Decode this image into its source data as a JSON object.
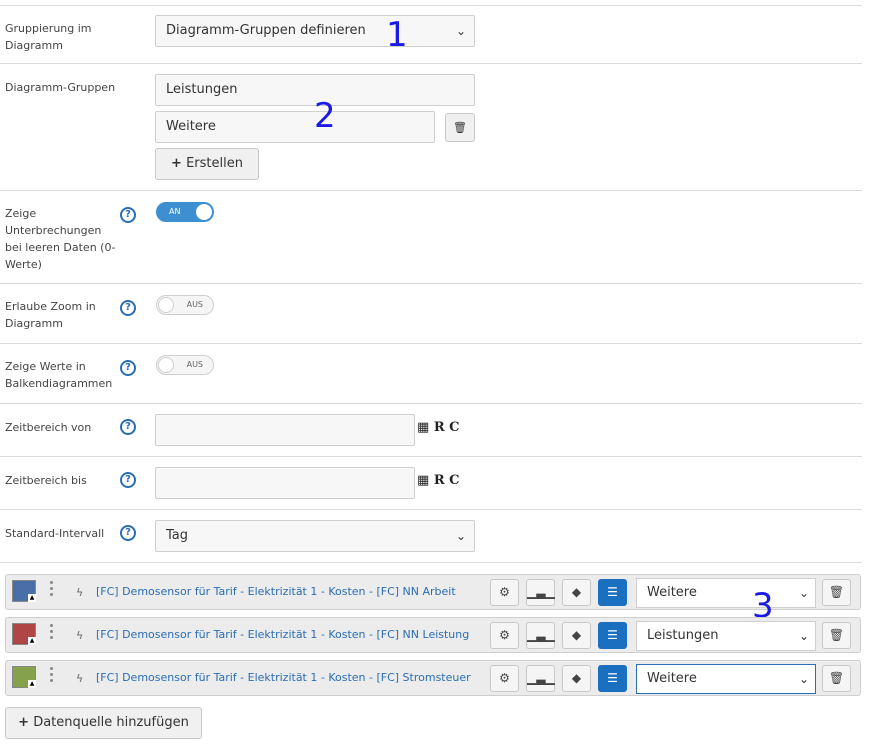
{
  "rows": {
    "grouping": {
      "label": "Gruppierung im Diagramm",
      "value": "Diagramm-Gruppen definieren"
    },
    "groups": {
      "label": "Diagramm-Gruppen",
      "items": [
        "Leistungen",
        "Weitere"
      ],
      "create_label": "Erstellen"
    },
    "show_gaps": {
      "label": "Zeige Unterbrechungen bei leeren Daten (0-Werte)",
      "state": "AN"
    },
    "allow_zoom": {
      "label": "Erlaube Zoom in Diagramm",
      "state": "AUS"
    },
    "show_values": {
      "label": "Zeige Werte in Balkendiagrammen",
      "state": "AUS"
    },
    "time_from": {
      "label": "Zeitbereich von",
      "value": "",
      "icons": [
        "R",
        "C"
      ]
    },
    "time_to": {
      "label": "Zeitbereich bis",
      "value": "",
      "icons": [
        "R",
        "C"
      ]
    },
    "interval": {
      "label": "Standard-Intervall",
      "value": "Tag"
    }
  },
  "annotations": [
    "1",
    "2",
    "3"
  ],
  "datasources": [
    {
      "color": "#4a6ea8",
      "name": "[FC] Demosensor für Tarif - Elektrizität 1 - Kosten - [FC] NN Arbeit",
      "group": "Weitere"
    },
    {
      "color": "#b04545",
      "name": "[FC] Demosensor für Tarif - Elektrizität 1 - Kosten - [FC] NN Leistung",
      "group": "Leistungen"
    },
    {
      "color": "#86a14c",
      "name": "[FC] Demosensor für Tarif - Elektrizität 1 - Kosten - [FC] Stromsteuer",
      "group": "Weitere"
    }
  ],
  "add_datasource_label": "Datenquelle hinzufügen",
  "icons": {
    "help": "?",
    "caret": "⌄",
    "trash": "🗑",
    "plus": "+",
    "bolt": "ϟ",
    "calendar": "▦"
  }
}
